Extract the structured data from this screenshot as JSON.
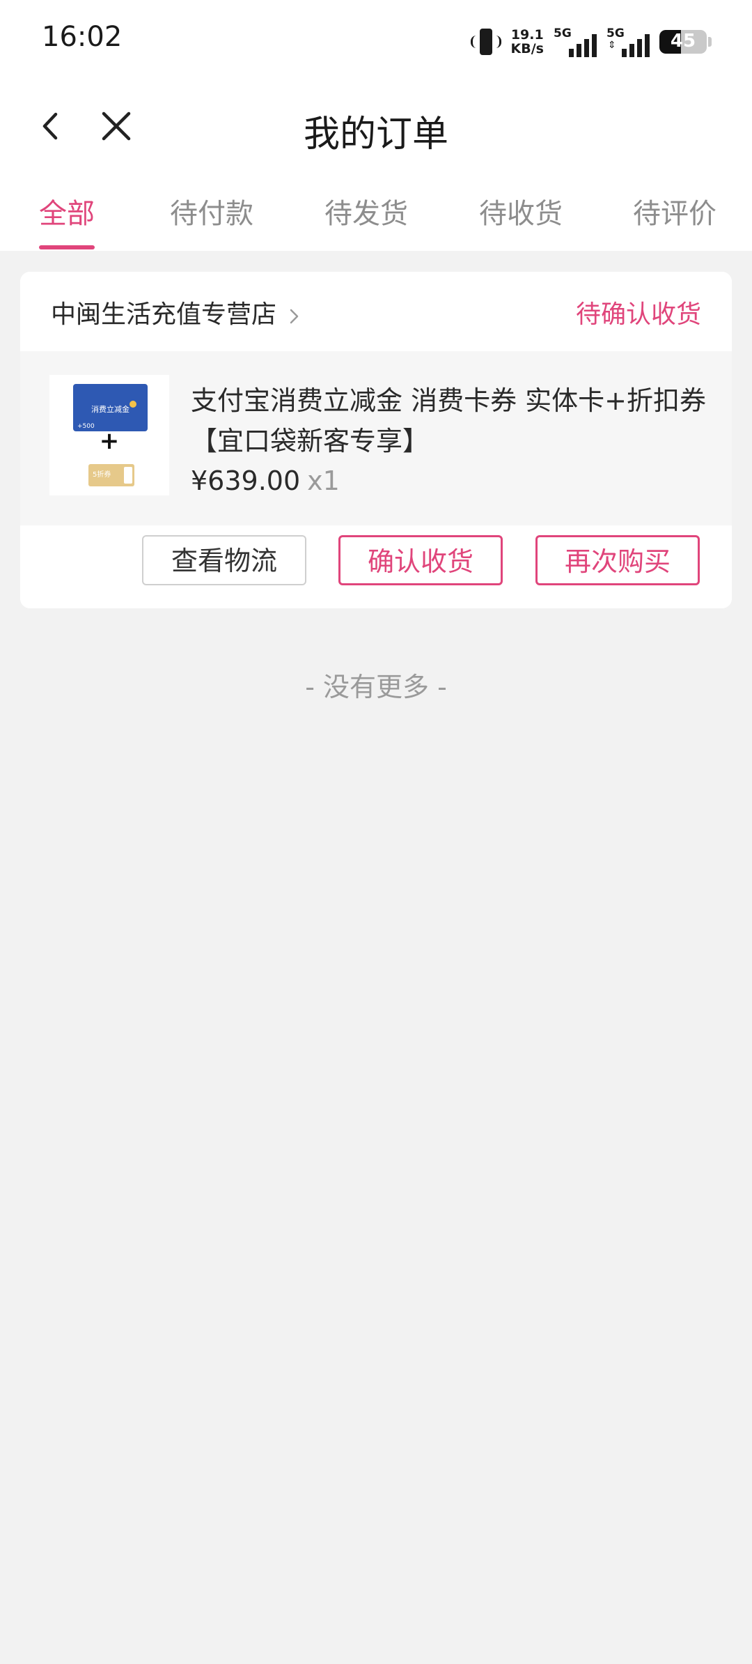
{
  "status_bar": {
    "time": "16:02",
    "net_speed_value": "19.1",
    "net_speed_unit": "KB/s",
    "signal1_label": "5G",
    "signal2_label": "5G",
    "battery": "45",
    "battery_level": 0.45
  },
  "navbar": {
    "back_icon": "chevron-left-icon",
    "close_icon": "close-icon",
    "title": "我的订单"
  },
  "tabs": [
    {
      "label": "全部",
      "active": true
    },
    {
      "label": "待付款",
      "active": false
    },
    {
      "label": "待发货",
      "active": false
    },
    {
      "label": "待收货",
      "active": false
    },
    {
      "label": "待评价",
      "active": false
    }
  ],
  "order": {
    "store_name": "中闽生活充值专营店",
    "status": "待确认收货",
    "product": {
      "thumb_card_text": "消费立减金",
      "thumb_card_amount": "+500",
      "thumb_plus": "+",
      "thumb_coupon_text": "5折券",
      "title": "支付宝消费立减金 消费卡券 实体卡+折扣券【宜口袋新客专享】",
      "price": "¥639.00",
      "quantity": "x1"
    },
    "buttons": {
      "logistics": "查看物流",
      "confirm": "确认收货",
      "rebuy": "再次购买"
    }
  },
  "footer": {
    "no_more": "- 没有更多 -"
  },
  "colors": {
    "accent": "#e0457b",
    "background": "#f2f2f2"
  }
}
